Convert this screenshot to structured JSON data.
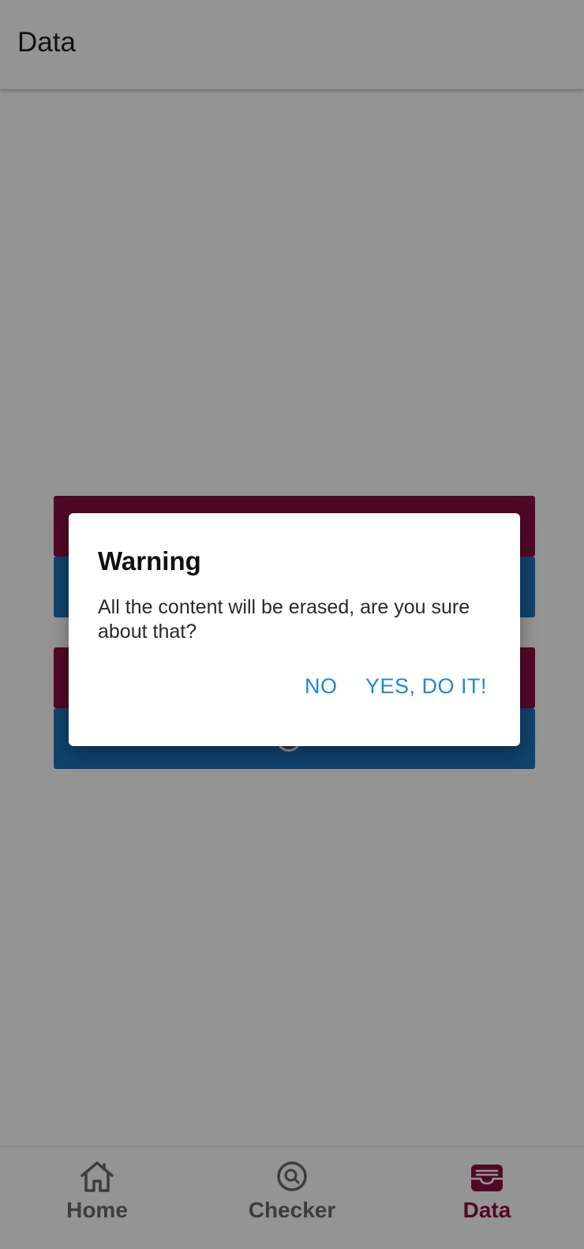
{
  "app_bar": {
    "title": "Data"
  },
  "content": {
    "buttons": [
      {
        "label": "",
        "color": "#8a1040"
      },
      {
        "label": "",
        "color": "#1c74bc"
      },
      {
        "label": "",
        "color": "#8a1040"
      },
      {
        "label": "",
        "color": "#1c74bc"
      }
    ]
  },
  "dialog": {
    "title": "Warning",
    "message": "All the content will be erased, are you sure about that?",
    "no_label": "NO",
    "yes_label": "YES, DO IT!"
  },
  "bottom_nav": {
    "items": [
      {
        "label": "Home",
        "icon": "home-icon",
        "active": false
      },
      {
        "label": "Checker",
        "icon": "search-circle-icon",
        "active": false
      },
      {
        "label": "Data",
        "icon": "inbox-icon",
        "active": true
      }
    ]
  },
  "colors": {
    "accent": "#8a1040",
    "blue": "#1c74bc",
    "dialog_button": "#1e88d8"
  }
}
